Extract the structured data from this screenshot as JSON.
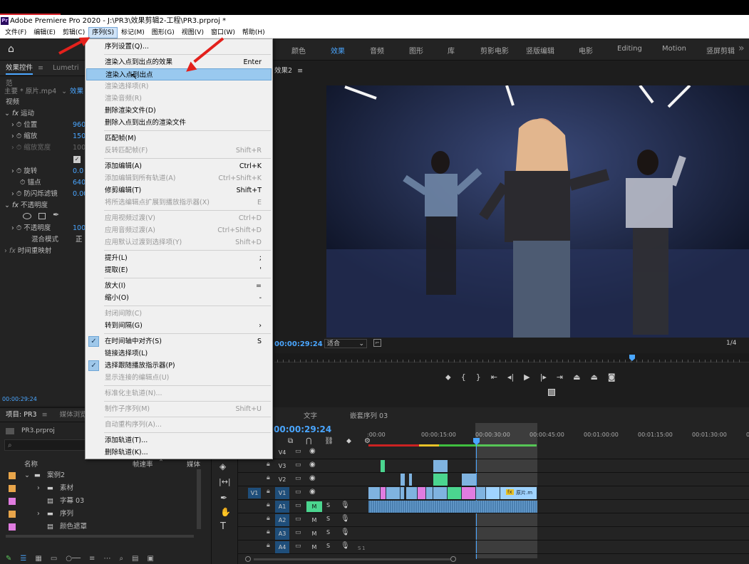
{
  "titlebar": {
    "app_icon": "Pr",
    "title": "Adobe Premiere Pro 2020 - J:\\PR3\\效果剪辑2-工程\\PR3.prproj *"
  },
  "menubar": [
    "文件(F)",
    "编辑(E)",
    "剪辑(C)",
    "序列(S)",
    "标记(M)",
    "图形(G)",
    "视图(V)",
    "窗口(W)",
    "帮助(H)"
  ],
  "workspace": {
    "tabs": [
      "颜色",
      "效果",
      "音频",
      "图形",
      "库",
      "剪影电影",
      "竖版编辑",
      "电影",
      "Editing",
      "Motion",
      "竖屏剪辑"
    ],
    "active": "效果"
  },
  "effect_controls": {
    "tab1": "效果控件",
    "tab2": "Lumetri 范",
    "source": "主要 * 原片.mp4",
    "source_right": "效果",
    "section": "视频",
    "motion": "运动",
    "position": "位置",
    "position_val": "960.",
    "scale": "缩放",
    "scale_val": "150.",
    "scale_width": "缩放宽度",
    "scale_width_val": "100",
    "uniform_check": "✓",
    "rotation": "旋转",
    "rotation_val": "0.0",
    "anchor": "锚点",
    "anchor_val": "640.",
    "anti_flicker": "防闪烁滤镜",
    "anti_flicker_val": "0.00",
    "opacity": "不透明度",
    "opacity_prop": "不透明度",
    "opacity_val": "100.",
    "blend": "混合模式",
    "blend_val": "正",
    "time_remap": "时间重映射",
    "timecode": "00:00:29:24",
    "fx": "fx"
  },
  "program_monitor": {
    "title": "效果2",
    "timecode": "00:00:29:24",
    "fit": "适合",
    "page": "1/4"
  },
  "sequence_menu": [
    {
      "label": "序列设置(Q)...",
      "shortcut": "",
      "enabled": true
    },
    {
      "sep": true
    },
    {
      "label": "渲染入点到出点的效果",
      "shortcut": "Enter",
      "enabled": true
    },
    {
      "label": "渲染入点到出点",
      "shortcut": "",
      "enabled": true,
      "highlight": true
    },
    {
      "label": "渲染选择项(R)",
      "shortcut": "",
      "enabled": false
    },
    {
      "label": "渲染音频(R)",
      "shortcut": "",
      "enabled": false
    },
    {
      "label": "删除渲染文件(D)",
      "shortcut": "",
      "enabled": true
    },
    {
      "label": "删除入点到出点的渲染文件",
      "shortcut": "",
      "enabled": true
    },
    {
      "sep": true
    },
    {
      "label": "匹配帧(M)",
      "shortcut": "",
      "enabled": true
    },
    {
      "label": "反转匹配帧(F)",
      "shortcut": "Shift+R",
      "enabled": false
    },
    {
      "sep": true
    },
    {
      "label": "添加编辑(A)",
      "shortcut": "Ctrl+K",
      "enabled": true
    },
    {
      "label": "添加编辑到所有轨道(A)",
      "shortcut": "Ctrl+Shift+K",
      "enabled": false
    },
    {
      "label": "修剪编辑(T)",
      "shortcut": "Shift+T",
      "enabled": true
    },
    {
      "label": "将所选编辑点扩展到播放指示器(X)",
      "shortcut": "E",
      "enabled": false
    },
    {
      "sep": true
    },
    {
      "label": "应用视频过渡(V)",
      "shortcut": "Ctrl+D",
      "enabled": false
    },
    {
      "label": "应用音频过渡(A)",
      "shortcut": "Ctrl+Shift+D",
      "enabled": false
    },
    {
      "label": "应用默认过渡到选择项(Y)",
      "shortcut": "Shift+D",
      "enabled": false
    },
    {
      "sep": true
    },
    {
      "label": "提升(L)",
      "shortcut": ";",
      "enabled": true
    },
    {
      "label": "提取(E)",
      "shortcut": "'",
      "enabled": true
    },
    {
      "sep": true
    },
    {
      "label": "放大(I)",
      "shortcut": "=",
      "enabled": true
    },
    {
      "label": "缩小(O)",
      "shortcut": "-",
      "enabled": true
    },
    {
      "sep": true
    },
    {
      "label": "封闭间隙(C)",
      "shortcut": "",
      "enabled": false
    },
    {
      "label": "转到间隔(G)",
      "shortcut": "›",
      "enabled": true
    },
    {
      "sep": true
    },
    {
      "label": "在时间轴中对齐(S)",
      "shortcut": "S",
      "enabled": true,
      "checked": true
    },
    {
      "label": "链接选择项(L)",
      "shortcut": "",
      "enabled": true
    },
    {
      "label": "选择跟随播放指示器(P)",
      "shortcut": "",
      "enabled": true,
      "checked": true
    },
    {
      "label": "显示连接的编辑点(U)",
      "shortcut": "",
      "enabled": false
    },
    {
      "sep": true
    },
    {
      "label": "标准化主轨道(N)...",
      "shortcut": "",
      "enabled": false
    },
    {
      "sep": true
    },
    {
      "label": "制作子序列(M)",
      "shortcut": "Shift+U",
      "enabled": false
    },
    {
      "sep": true
    },
    {
      "label": "自动重构序列(A)...",
      "shortcut": "",
      "enabled": false
    },
    {
      "sep": true
    },
    {
      "label": "添加轨道(T)...",
      "shortcut": "",
      "enabled": true
    },
    {
      "label": "删除轨道(K)...",
      "shortcut": "",
      "enabled": true
    }
  ],
  "project": {
    "tab1": "项目: PR3",
    "tab2": "媒体浏览",
    "file": "PR3.prproj",
    "col_name": "名称",
    "col_rate": "帧速率",
    "col_media": "媒体",
    "items": [
      {
        "name": "案例2",
        "type": "folder",
        "color": "#e8a54a",
        "indent": 0,
        "twisty": "⌄"
      },
      {
        "name": "素材",
        "type": "folder",
        "color": "#e8a54a",
        "indent": 1,
        "twisty": "›"
      },
      {
        "name": "字幕 03",
        "type": "file",
        "color": "#e07ce0",
        "indent": 1,
        "twisty": ""
      },
      {
        "name": "序列",
        "type": "folder",
        "color": "#e8a54a",
        "indent": 1,
        "twisty": "›"
      },
      {
        "name": "颜色遮罩",
        "type": "file",
        "color": "#e07ce0",
        "indent": 1,
        "twisty": ""
      }
    ]
  },
  "timeline": {
    "tab": "文字",
    "seq_tab": "嵌套序列 03",
    "timecode": "00:00:29:24",
    "ruler": [
      ":00:00",
      "00:00:15:00",
      "00:00:30:00",
      "00:00:45:00",
      "00:01:00:00",
      "00:01:15:00",
      "00:01:30:00",
      "00:01:45:00"
    ],
    "video_tracks": [
      "V4",
      "V3",
      "V2",
      "V1"
    ],
    "audio_tracks": [
      "A1",
      "A2",
      "A3",
      "A4"
    ],
    "src_v": "V1",
    "clip_label": "原片.m",
    "solo": "S",
    "mute": "M",
    "fx_label": "fx"
  },
  "colors": {
    "accent": "#4aa6ff",
    "menu_highlight": "#99c9ef",
    "annotation": "#e3211c"
  }
}
